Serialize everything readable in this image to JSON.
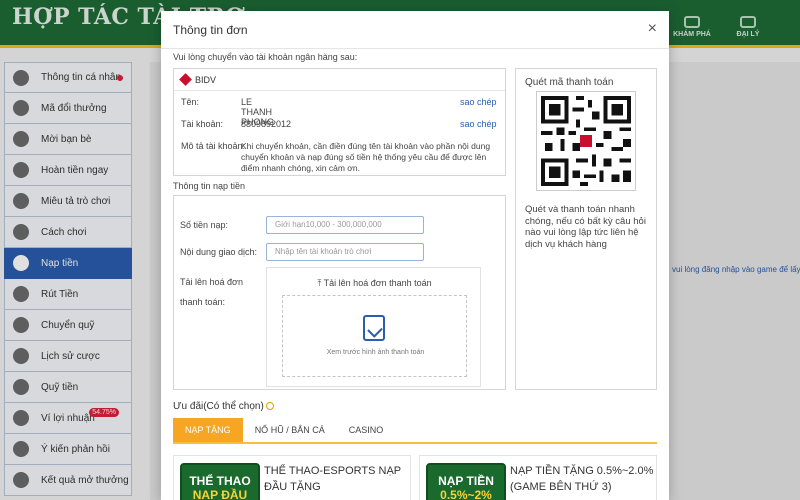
{
  "header": {
    "brand": "HỢP TÁC TÀI TRỢ",
    "nav": [
      {
        "label": "KHÁM PHÁ"
      },
      {
        "label": "ĐẠI LÝ"
      }
    ]
  },
  "sidebar": {
    "items": [
      {
        "label": "Thông tin cá nhân",
        "badge_dot": true
      },
      {
        "label": "Mã đổi thưởng"
      },
      {
        "label": "Mời bạn bè"
      },
      {
        "label": "Hoàn tiền ngay"
      },
      {
        "label": "Miêu tả trò chơi"
      },
      {
        "label": "Cách chơi"
      },
      {
        "label": "Nạp tiền",
        "active": true
      },
      {
        "label": "Rút Tiền"
      },
      {
        "label": "Chuyển quỹ"
      },
      {
        "label": "Lịch sử cược"
      },
      {
        "label": "Quỹ tiền"
      },
      {
        "label": "Ví lợi nhuận",
        "badge": "54.75%"
      },
      {
        "label": "Ý kiến phản hồi"
      },
      {
        "label": "Kết quả mở thưởng"
      }
    ]
  },
  "background": {
    "right_note": "vui lòng đăng nhập vào game để lấy số"
  },
  "modal": {
    "title": "Thông tin đơn",
    "close": "×",
    "instruction": "Vui lòng chuyển vào tài khoản ngân hàng sau:",
    "bank": {
      "name": "BIDV",
      "name_label": "Tên:",
      "name_value": "LE THANH PHONG",
      "account_label": "Tài khoản:",
      "account_value": "8809892012",
      "copy_label": "sao chép",
      "desc_label": "Mô tả tài khoản:",
      "desc_value": "Khi chuyển khoản, cần điền đúng tên tài khoản vào phần nội dung chuyển khoản và nạp đúng số tiền hệ thống yêu cầu để được lên điểm nhanh chóng, xin cảm ơn."
    },
    "qr": {
      "title": "Quét mã thanh toán",
      "desc": "Quét và thanh toán nhanh chóng, nếu có bất kỳ câu hỏi nào vui lòng lập tức liên hệ dịch vụ khách hàng"
    },
    "deposit": {
      "section_label": "Thông tin nạp tiền",
      "amount_label": "Số tiền nạp:",
      "amount_placeholder": "Giới hạn10,000 - 300,000,000",
      "content_label": "Nội dung giao dịch:",
      "content_placeholder": "Nhập tên tài khoản trò chơi",
      "upload_label": "Tải lên hoá đơn thanh toán:",
      "upload_button": "Tải lên hoá đơn thanh toán",
      "preview_label": "Xem trước hình ảnh thanh toán"
    },
    "promo": {
      "label": "Ưu đãi(Có thể chọn)",
      "tabs": [
        {
          "label": "NẠP TẶNG",
          "active": true
        },
        {
          "label": "NỔ HŨ / BẮN CÁ"
        },
        {
          "label": "CASINO"
        }
      ],
      "cards": [
        {
          "img_line1": "THỂ THAO",
          "img_line2": "NẠP ĐẦU",
          "text": "THỂ THAO-ESPORTS NẠP ĐẦU TẶNG"
        },
        {
          "img_line1": "NẠP TIỀN",
          "img_line2": "0.5%~2%",
          "text": "NẠP TIỀN TẶNG 0.5%~2.0% (GAME BÊN THỨ 3)"
        }
      ]
    }
  }
}
